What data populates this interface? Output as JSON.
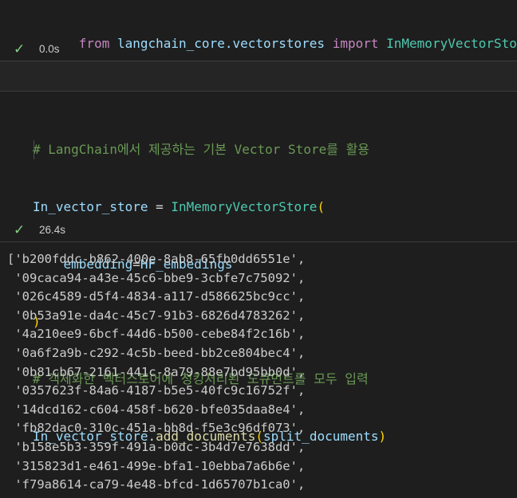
{
  "cell1": {
    "tokens": {
      "from": "from",
      "module": "langchain_core.vectorstores",
      "import": "import",
      "cls": "InMemoryVectorStore"
    },
    "status": {
      "icon": "check-icon",
      "time": "0.0s"
    }
  },
  "cell2": {
    "comment1": "# LangChain에서 제공하는 기본 Vector Store를 활용",
    "line2": {
      "var": "In_vector_store",
      "op": " = ",
      "cls": "InMemoryVectorStore",
      "paren": "("
    },
    "line3": {
      "param": "embedding",
      "eq": "=",
      "arg": "HF_embedings"
    },
    "line4": {
      "paren": ")"
    },
    "comment2": "# 객체화한 벡터스토어에 청킹처리된 도큐먼트를 모두 입력",
    "line6": {
      "var": "In_vector_store",
      "dot": ".",
      "fn": "add_documents",
      "open": "(",
      "arg": "split_documents",
      "close": ")"
    },
    "status": {
      "icon": "check-icon",
      "time": "26.4s"
    }
  },
  "output": {
    "lines": [
      "['b200fddc-b862-400e-8ab8-65fb0dd6551e',",
      " '09caca94-a43e-45c6-bbe9-3cbfe7c75092',",
      " '026c4589-d5f4-4834-a117-d586625bc9cc',",
      " '0b53a91e-da4c-45c7-91b3-6826d4783262',",
      " '4a210ee9-6bcf-44d6-b500-cebe84f2c16b',",
      " '0a6f2a9b-c292-4c5b-beed-bb2ce804bec4',",
      " '0b81cb67-2161-441c-8a79-88e7bd95bb0d',",
      " '0357623f-84a6-4187-b5e5-40fc9c16752f',",
      " '14dcd162-c604-458f-b620-bfe035daa8e4',",
      " 'fb82dac0-310c-451a-bb8d-f5e3c96df073',",
      " 'b158e5b3-359f-491a-b0dc-3b4d7e7638dd',",
      " '315823d1-e461-499e-bfa1-10ebba7a6b6e',",
      " 'f79a8614-ca79-4e48-bfcd-1d65707b1ca0',"
    ]
  },
  "colors": {
    "background": "#1e1e1e",
    "keyword": "#c586c0",
    "class": "#4ec9b0",
    "function": "#dcdcaa",
    "variable": "#9cdcfe",
    "comment": "#6a9955",
    "bracket": "#ffd700",
    "success": "#89d185"
  }
}
